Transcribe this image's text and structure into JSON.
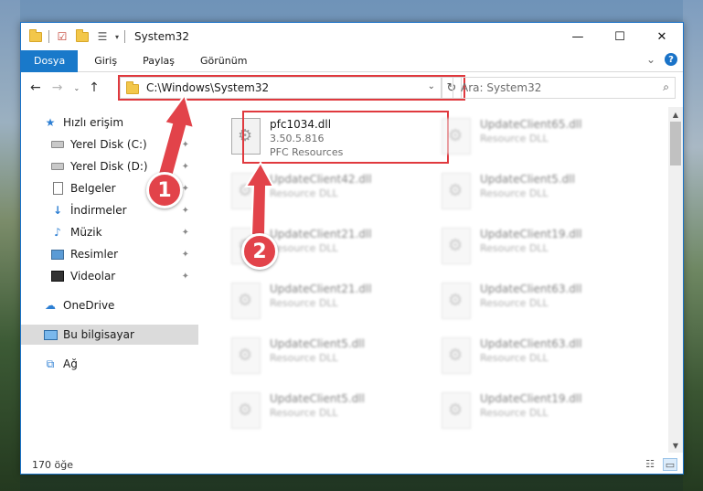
{
  "window": {
    "title": "System32",
    "controls": {
      "minimize": "—",
      "maximize": "☐",
      "close": "✕"
    }
  },
  "ribbon": {
    "tabs": [
      "Dosya",
      "Giriş",
      "Paylaş",
      "Görünüm"
    ],
    "expand_glyph": "⌄",
    "help_glyph": "?"
  },
  "navigation": {
    "back": "←",
    "forward": "→",
    "recent": "⌄",
    "up": "↑"
  },
  "address": {
    "path": "C:\\Windows\\System32",
    "dropdown_glyph": "⌄",
    "refresh_glyph": "↻"
  },
  "search": {
    "placeholder": "Ara: System32",
    "icon_glyph": "⌕"
  },
  "sidebar": {
    "quick_access": "Hızlı erişim",
    "items": [
      {
        "label": "Yerel Disk (C:)"
      },
      {
        "label": "Yerel Disk (D:)"
      },
      {
        "label": "Belgeler"
      },
      {
        "label": "İndirmeler"
      },
      {
        "label": "Müzik"
      },
      {
        "label": "Resimler"
      },
      {
        "label": "Videolar"
      }
    ],
    "onedrive": "OneDrive",
    "this_pc": "Bu bilgisayar",
    "network": "Ağ",
    "pin_glyph": "📌"
  },
  "files": {
    "main": {
      "name": "pfc1034.dll",
      "version": "3.50.5.816",
      "company": "PFC Resources"
    },
    "blurred": [
      {
        "name": "UpdateClient65.dll",
        "desc": "Resource DLL"
      },
      {
        "name": "UpdateClient42.dll",
        "desc": "Resource DLL"
      },
      {
        "name": "UpdateClient5.dll",
        "desc": "Resource DLL"
      },
      {
        "name": "UpdateClient21.dll",
        "desc": "Resource DLL"
      },
      {
        "name": "UpdateClient19.dll",
        "desc": "Resource DLL"
      },
      {
        "name": "UpdateClient21.dll",
        "desc": "Resource DLL"
      },
      {
        "name": "UpdateClient63.dll",
        "desc": "Resource DLL"
      },
      {
        "name": "UpdateClient5.dll",
        "desc": "Resource DLL"
      },
      {
        "name": "UpdateClient63.dll",
        "desc": "Resource DLL"
      },
      {
        "name": "UpdateClient5.dll",
        "desc": "Resource DLL"
      },
      {
        "name": "UpdateClient19.dll",
        "desc": "Resource DLL"
      }
    ]
  },
  "status": {
    "count": "170 öğe"
  },
  "annotations": {
    "step1": "1",
    "step2": "2",
    "color": "#e2434a"
  },
  "colors": {
    "accent": "#1979ca",
    "highlight": "#e0393e"
  }
}
